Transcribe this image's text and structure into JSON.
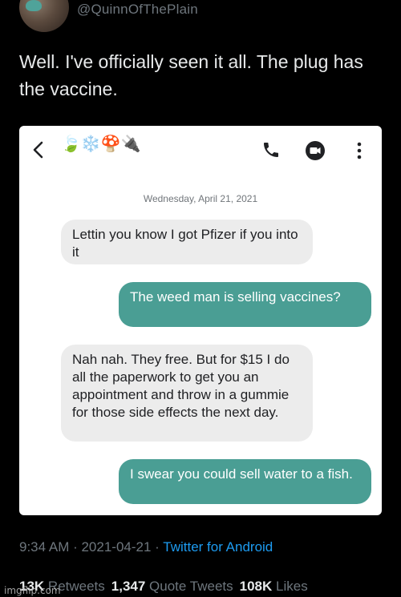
{
  "tweet": {
    "handle": "@QuinnOfThePlain",
    "text": "Well. I've officially seen it all. The plug has the vaccine.",
    "timestamp": "9:34 AM · 2021-04-21 · ",
    "source": "Twitter for Android"
  },
  "screenshot": {
    "contact_name_emoji": "🍃❄️🍄🔌",
    "date_header": "Wednesday, April 21, 2021",
    "messages": [
      {
        "direction": "incoming",
        "text": "Lettin you know I got Pfizer if you into it"
      },
      {
        "direction": "outgoing",
        "text": "The weed man is selling vaccines?"
      },
      {
        "direction": "incoming",
        "text": "Nah nah. They free. But for $15 I do all the paperwork to get you an appointment and throw in a gummie for those side effects the next day."
      },
      {
        "direction": "outgoing",
        "text": "I swear you could sell water to a fish."
      }
    ],
    "icons": {
      "back": "back-arrow-icon",
      "call": "phone-icon",
      "video": "video-call-icon",
      "more": "more-vertical-icon"
    }
  },
  "stats": {
    "retweets_count": "13K",
    "retweets_label": " Retweets",
    "quote_count": "1,347",
    "quote_label": " Quote Tweets",
    "likes_count": "108K",
    "likes_label": " Likes"
  },
  "watermark": "imgflip.com",
  "colors": {
    "background": "#000000",
    "outgoing_bubble": "#4a9e94",
    "incoming_bubble": "#ececec",
    "link": "#1d9bf0"
  }
}
